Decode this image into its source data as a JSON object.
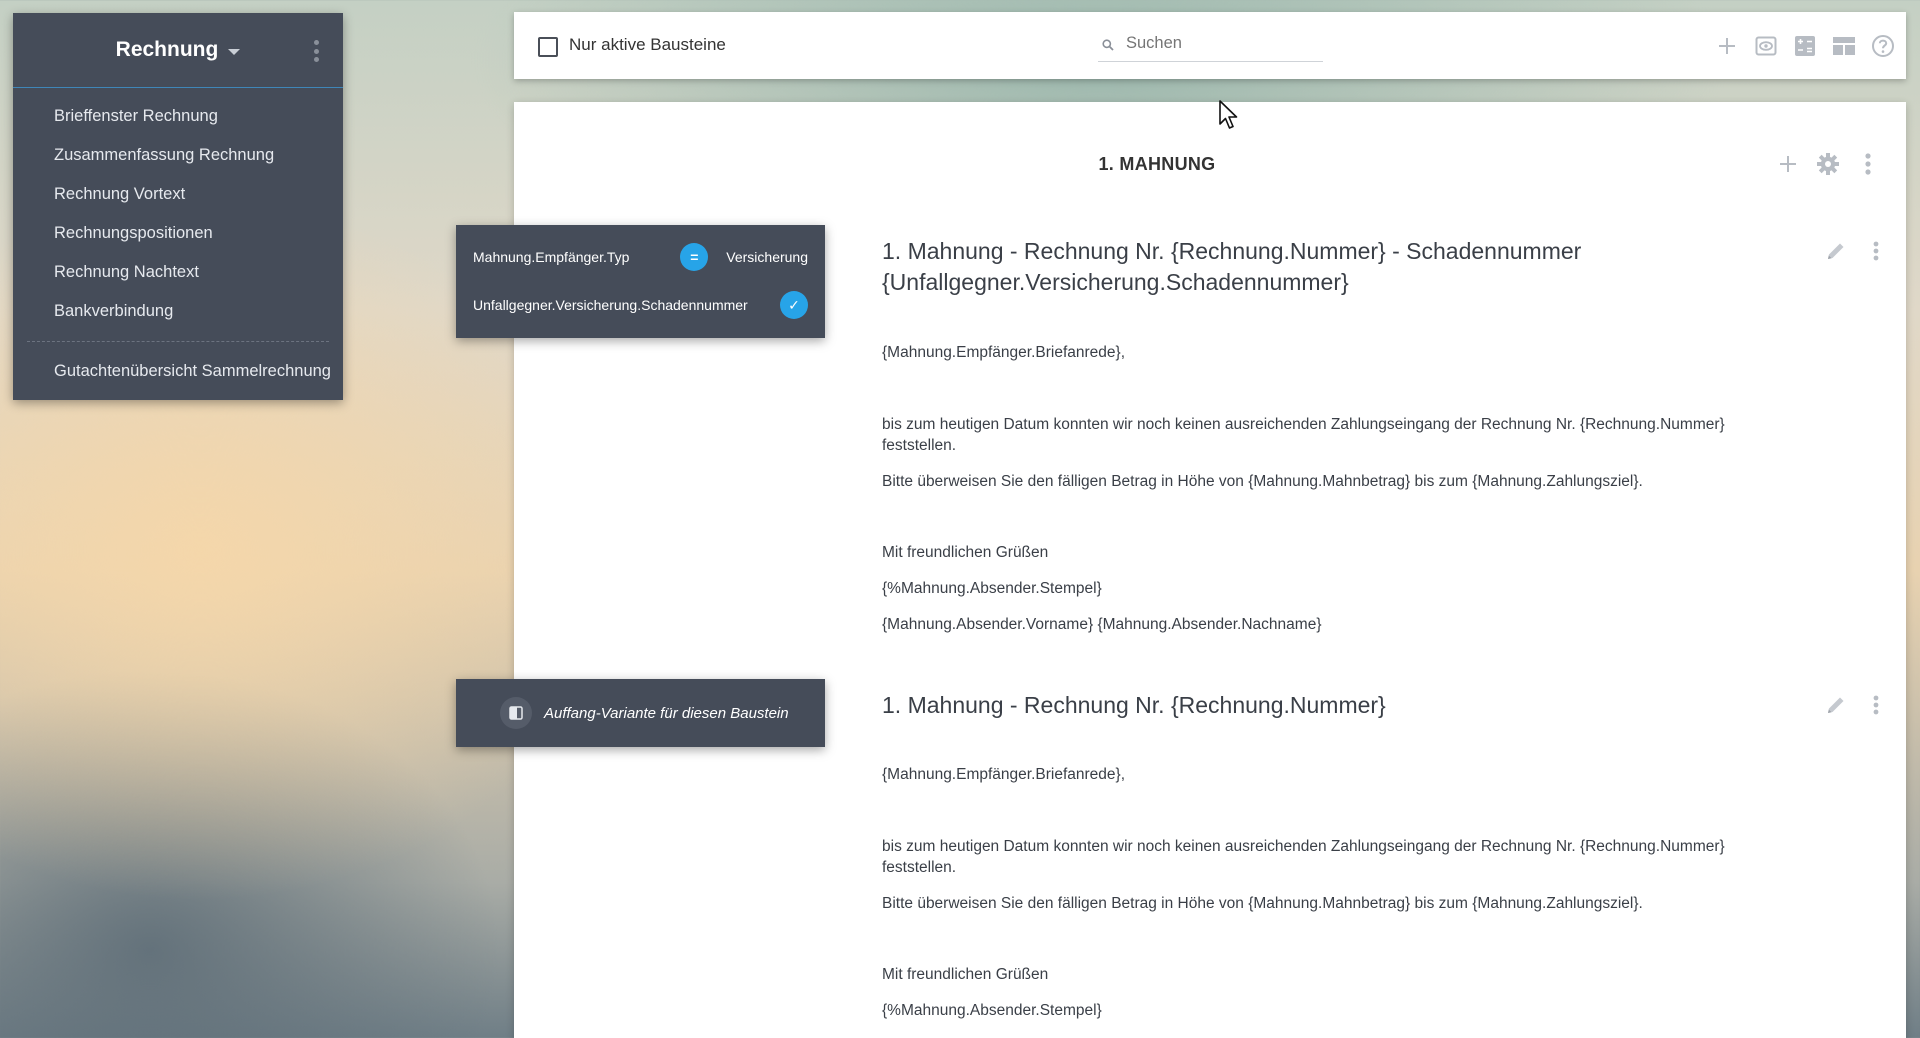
{
  "sidebar": {
    "title": "Rechnung",
    "items": [
      {
        "label": "Brieffenster Rechnung"
      },
      {
        "label": "Zusammenfassung Rechnung"
      },
      {
        "label": "Rechnung Vortext"
      },
      {
        "label": "Rechnungspositionen"
      },
      {
        "label": "Rechnung Nachtext"
      },
      {
        "label": "Bankverbindung"
      }
    ],
    "extra_item": {
      "label": "Gutachtenübersicht Sammelrechnung"
    }
  },
  "toolbar": {
    "checkbox_label": "Nur aktive Bausteine",
    "checkbox_checked": false,
    "search_placeholder": "Suchen",
    "icons": [
      "plus-icon",
      "eye-icon",
      "calculator-icon",
      "layout-icon",
      "help-icon"
    ]
  },
  "panel": {
    "title": "1. MAHNUNG",
    "icons": [
      "plus-icon",
      "gear-icon",
      "more-vertical-icon"
    ]
  },
  "blocks": [
    {
      "title": "1. Mahnung - Rechnung Nr. {Rechnung.Nummer} - Schadennummer {Unfallgegner.Versicherung.Schadennummer}",
      "salutation": "{Mahnung.Empfänger.Briefanrede},",
      "para1": "bis zum heutigen Datum konnten wir noch keinen ausreichenden Zahlungseingang der Rechnung Nr. {Rechnung.Nummer} feststellen.",
      "para2": "Bitte überweisen Sie den fälligen Betrag in Höhe von {Mahnung.Mahnbetrag} bis zum {Mahnung.Zahlungsziel}.",
      "closing": "Mit freundlichen Grüßen",
      "stamp": "{%Mahnung.Absender.Stempel}",
      "name": "{Mahnung.Absender.Vorname} {Mahnung.Absender.Nachname}",
      "conditions": [
        {
          "field": "Mahnung.Empfänger.Typ",
          "operator": "=",
          "value": "Versicherung"
        },
        {
          "field": "Unfallgegner.Versicherung.Schadennummer",
          "operator": "✓",
          "value": ""
        }
      ]
    },
    {
      "title": "1. Mahnung - Rechnung Nr. {Rechnung.Nummer}",
      "salutation": "{Mahnung.Empfänger.Briefanrede},",
      "para1": "bis zum heutigen Datum konnten wir noch keinen ausreichenden Zahlungseingang der Rechnung Nr. {Rechnung.Nummer} feststellen.",
      "para2": "Bitte überweisen Sie den fälligen Betrag in Höhe von {Mahnung.Mahnbetrag} bis zum {Mahnung.Zahlungsziel}.",
      "closing": "Mit freundlichen Grüßen",
      "stamp": "{%Mahnung.Absender.Stempel}",
      "fallback": "Auffang-Variante für diesen Baustein"
    }
  ],
  "colors": {
    "sidebar_bg": "#454c59",
    "accent": "#27a4e8",
    "text": "#3a3f47"
  }
}
